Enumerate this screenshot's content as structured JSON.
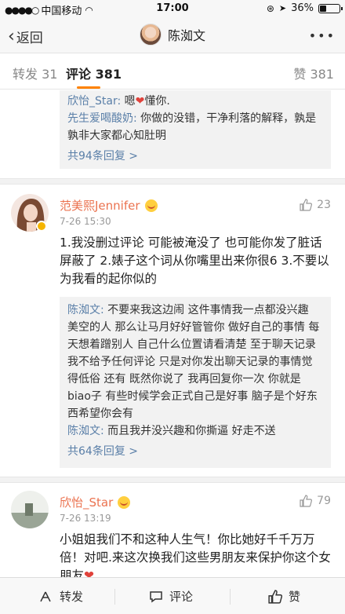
{
  "status_bar": {
    "carrier": "中国移动",
    "time": "17:00",
    "battery": "36%",
    "battery_level": 0.36
  },
  "nav": {
    "back": "返回",
    "title": "陈洳文"
  },
  "tabs": {
    "repost": "转发 31",
    "comments": "评论 381",
    "likes": "赞 381"
  },
  "top_thread": {
    "line1_name": "欣怡_Star:",
    "line1_text_a": " 嗯",
    "line1_text_b": "懂你.",
    "line2_name": "先生爱喝酸奶:",
    "line2_text": " 你做的没错，干净利落的解释，孰是孰非大家都心知肚明",
    "more": "共94条回复 >"
  },
  "comment1": {
    "name": "范美熙Jennifer",
    "time": "7-26 15:30",
    "likes": "23",
    "text": "1.我没删过评论 可能被淹没了 也可能你发了脏话屏蔽了 2.婊子这个词从你嘴里出来你很6 3.不要以为我看的起你似的",
    "reply1_name": "陈洳文:",
    "reply1_text": " 不要来我这边闹 这件事情我一点都没兴趣 美空的人 那么让马月好好管管你 做好自己的事情 每天想着蹭别人 自己什么位置请看清楚 至于聊天记录 我不给予任何评论 只是对你发出聊天记录的事情觉得低俗 还有 既然你说了 我再回复你一次 你就是biao子 有些时候学会正式自己是好事 脑子是个好东西希望你会有",
    "reply2_name": "陈洳文:",
    "reply2_text": " 而且我并没兴趣和你撕逼 好走不送",
    "more": "共64条回复 >"
  },
  "comment2": {
    "name": "欣怡_Star",
    "time": "7-26 13:19",
    "likes": "79",
    "text": "小姐姐我们不和这种人生气！你比她好千千万万倍！对吧.来这次换我们这些男朋友来保护你这个女朋友"
  },
  "bottom_bar": {
    "repost": "转发",
    "comment": "评论",
    "like": "赞"
  }
}
